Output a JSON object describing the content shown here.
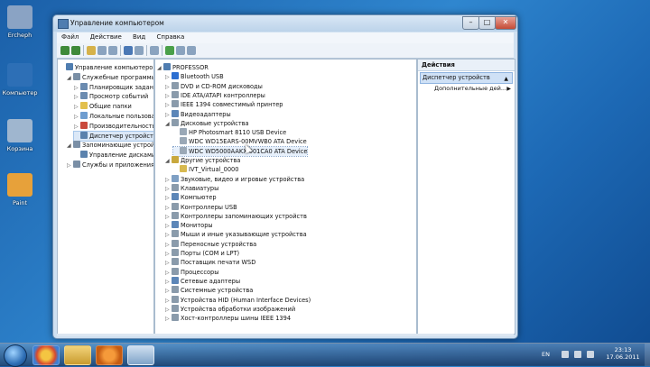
{
  "desktop": {
    "icons": [
      {
        "label": "Ercheph",
        "color": "#8aa3c4"
      },
      {
        "label": "Компьютер",
        "color": "#2d6fb6"
      },
      {
        "label": "Корзина",
        "color": "#9fb6cf"
      },
      {
        "label": "Paint",
        "color": "#e7a13a"
      }
    ]
  },
  "window": {
    "title": "Управление компьютером",
    "menu": [
      "Файл",
      "Действие",
      "Вид",
      "Справка"
    ]
  },
  "left_tree": [
    {
      "label": "Управление компьютером (л",
      "expander": "",
      "level": 0,
      "color": "#4f7db0"
    },
    {
      "label": "Служебные программы",
      "expander": "◢",
      "level": 1,
      "color": "#7a8fa6"
    },
    {
      "label": "Планировщик задани",
      "expander": "▷",
      "level": 2,
      "color": "#6b8bb0"
    },
    {
      "label": "Просмотр событий",
      "expander": "▷",
      "level": 2,
      "color": "#6b8bb0"
    },
    {
      "label": "Общие папки",
      "expander": "▷",
      "level": 2,
      "color": "#e3c04d"
    },
    {
      "label": "Локальные пользовате",
      "expander": "▷",
      "level": 2,
      "color": "#6f9dd0"
    },
    {
      "label": "Производительность",
      "expander": "▷",
      "level": 2,
      "color": "#c9493c"
    },
    {
      "label": "Диспетчер устройств",
      "expander": "",
      "level": 2,
      "color": "#5b82ad",
      "selected": true
    },
    {
      "label": "Запоминающие устройст",
      "expander": "◢",
      "level": 1,
      "color": "#7a8fa6"
    },
    {
      "label": "Управление дисками",
      "expander": "",
      "level": 2,
      "color": "#5b82ad"
    },
    {
      "label": "Службы и приложения",
      "expander": "▷",
      "level": 1,
      "color": "#7a8fa6"
    }
  ],
  "device_tree": [
    {
      "label": "PROFESSOR",
      "expander": "◢",
      "level": 0,
      "color": "#4f7db0"
    },
    {
      "label": "Bluetooth USB",
      "expander": "▷",
      "level": 1,
      "color": "#2c6fd1"
    },
    {
      "label": "DVD и CD-ROM дисководы",
      "expander": "▷",
      "level": 1,
      "color": "#8a9bab"
    },
    {
      "label": "IDE ATA/ATAPI контроллеры",
      "expander": "▷",
      "level": 1,
      "color": "#8a9bab"
    },
    {
      "label": "IEEE 1394 совместимый принтер",
      "expander": "▷",
      "level": 1,
      "color": "#8a9bab"
    },
    {
      "label": "Видеоадаптеры",
      "expander": "▷",
      "level": 1,
      "color": "#5c86b8"
    },
    {
      "label": "Дисковые устройства",
      "expander": "◢",
      "level": 1,
      "color": "#8a9bab"
    },
    {
      "label": "HP Photosmart 8110 USB Device",
      "expander": "",
      "level": 2,
      "color": "#9aa8b6"
    },
    {
      "label": "WDC WD15EARS-00MVWB0 ATA Device",
      "expander": "",
      "level": 2,
      "color": "#9aa8b6"
    },
    {
      "label": "WDC WD5000AAKX-001CA0 ATA Device",
      "expander": "",
      "level": 2,
      "color": "#9aa8b6",
      "hover": true
    },
    {
      "label": "Другие устройства",
      "expander": "◢",
      "level": 1,
      "color": "#c8a83d"
    },
    {
      "label": "IVT_Virtual_0000",
      "expander": "",
      "level": 2,
      "color": "#d7b950"
    },
    {
      "label": "Звуковые, видео и игровые устройства",
      "expander": "▷",
      "level": 1,
      "color": "#7fa0c4"
    },
    {
      "label": "Клавиатуры",
      "expander": "▷",
      "level": 1,
      "color": "#8a9bab"
    },
    {
      "label": "Компьютер",
      "expander": "▷",
      "level": 1,
      "color": "#5c86b8"
    },
    {
      "label": "Контроллеры USB",
      "expander": "▷",
      "level": 1,
      "color": "#8a9bab"
    },
    {
      "label": "Контроллеры запоминающих устройств",
      "expander": "▷",
      "level": 1,
      "color": "#8a9bab"
    },
    {
      "label": "Мониторы",
      "expander": "▷",
      "level": 1,
      "color": "#5c86b8"
    },
    {
      "label": "Мыши и иные указывающие устройства",
      "expander": "▷",
      "level": 1,
      "color": "#8a9bab"
    },
    {
      "label": "Переносные устройства",
      "expander": "▷",
      "level": 1,
      "color": "#8a9bab"
    },
    {
      "label": "Порты (COM и LPT)",
      "expander": "▷",
      "level": 1,
      "color": "#8a9bab"
    },
    {
      "label": "Поставщик печати WSD",
      "expander": "▷",
      "level": 1,
      "color": "#8a9bab"
    },
    {
      "label": "Процессоры",
      "expander": "▷",
      "level": 1,
      "color": "#8a9bab"
    },
    {
      "label": "Сетевые адаптеры",
      "expander": "▷",
      "level": 1,
      "color": "#5c86b8"
    },
    {
      "label": "Системные устройства",
      "expander": "▷",
      "level": 1,
      "color": "#8a9bab"
    },
    {
      "label": "Устройства HID (Human Interface Devices)",
      "expander": "▷",
      "level": 1,
      "color": "#8a9bab"
    },
    {
      "label": "Устройства обработки изображений",
      "expander": "▷",
      "level": 1,
      "color": "#8a9bab"
    },
    {
      "label": "Хост-контроллеры шины IEEE 1394",
      "expander": "▷",
      "level": 1,
      "color": "#8a9bab"
    }
  ],
  "actions": {
    "header": "Действия",
    "selected": "Диспетчер устройств",
    "more": "Дополнительные дей..."
  },
  "taskbar": {
    "language": "EN",
    "time": "23:13",
    "date": "17.06.2011"
  }
}
